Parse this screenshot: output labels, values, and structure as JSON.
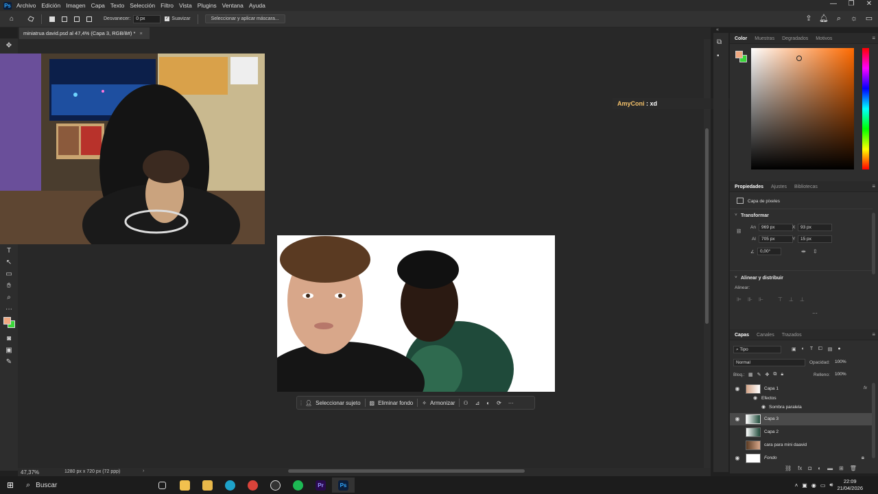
{
  "app": {
    "logo": "Ps",
    "menu": [
      "Archivo",
      "Edición",
      "Imagen",
      "Capa",
      "Texto",
      "Selección",
      "Filtro",
      "Vista",
      "Plugins",
      "Ventana",
      "Ayuda"
    ],
    "window_controls": [
      "—",
      "❐",
      "✕"
    ]
  },
  "options_bar": {
    "feather_label": "Desvanecer:",
    "feather_value": "0 px",
    "antialias_label": "Suavizar",
    "select_mask_label": "Seleccionar y aplicar máscara..."
  },
  "document": {
    "tab_title": "miniatrua david.psd al 47,4% (Capa 3, RGB/8#) *",
    "tab_close": "×"
  },
  "status": {
    "zoom": "47,37%",
    "dimensions": "1280 px x 720 px (72 ppp)"
  },
  "context_bar": {
    "select_subject": "Seleccionar sujeto",
    "remove_background": "Eliminar fondo",
    "harmonize": "Armonizar",
    "more": "···"
  },
  "chat": {
    "user": "AmyConi",
    "message": " : xd",
    "user_color": "#f5c26b"
  },
  "color_panel": {
    "tabs": [
      "Color",
      "Muestras",
      "Degradados",
      "Motivos"
    ],
    "foreground": "#f0a880",
    "background": "#3ad63a",
    "hue": "#ff6a00"
  },
  "properties_panel": {
    "tabs": [
      "Propiedades",
      "Ajustes",
      "Bibliotecas"
    ],
    "layer_kind": "Capa de píxeles",
    "transform_title": "Transformar",
    "w_label": "An",
    "w_value": "969 px",
    "h_label": "Al",
    "h_value": "705 px",
    "x_label": "X",
    "x_value": "93 px",
    "y_label": "Y",
    "y_value": "15 px",
    "angle_value": "0,00°",
    "align_title": "Alinear y distribuir",
    "align_label": "Alinear:",
    "more": "···"
  },
  "layers_panel": {
    "tabs": [
      "Capas",
      "Canales",
      "Trazados"
    ],
    "filter_kind": "Tipo",
    "blend_mode": "Normal",
    "opacity_label": "Opacidad:",
    "opacity_value": "100%",
    "lock_label": "Bloq.:",
    "fill_label": "Relleno:",
    "fill_value": "100%",
    "layers": [
      {
        "name": "Capa 1",
        "visible": true,
        "fx": "fx"
      },
      {
        "name": "Efectos",
        "sub": true
      },
      {
        "name": "Sombra paralela",
        "sub": true
      },
      {
        "name": "Capa 3",
        "visible": true,
        "selected": true
      },
      {
        "name": "Capa 2",
        "visible": false
      },
      {
        "name": "cara para mini daavid",
        "visible": false
      },
      {
        "name": "Fondo",
        "visible": true,
        "locked": true
      }
    ]
  },
  "taskbar": {
    "search_placeholder": "Buscar",
    "time": "22:09",
    "date": "21/04/2026"
  }
}
